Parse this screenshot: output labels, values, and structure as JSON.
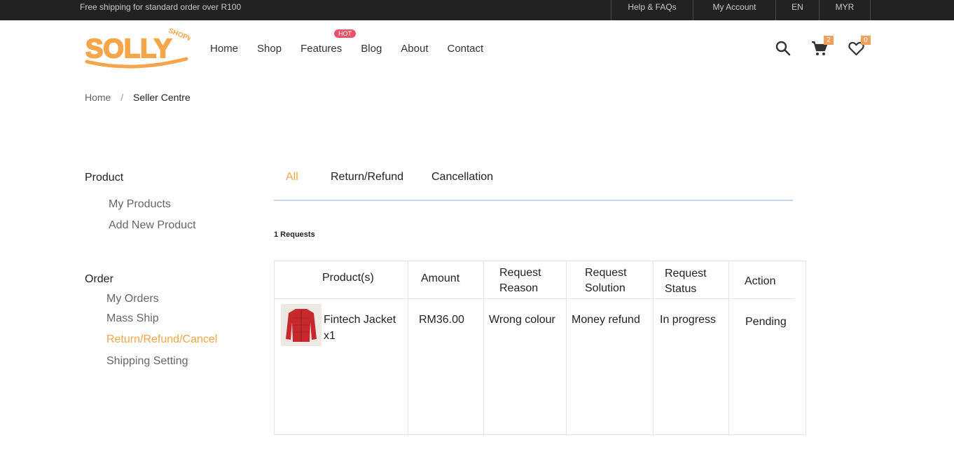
{
  "topbar": {
    "promo": "Free shipping for standard order over R100",
    "links": [
      "Help & FAQs",
      "My Account",
      "EN",
      "MYR"
    ]
  },
  "logo": {
    "main": "SOLLY",
    "sub": "SHOPWE"
  },
  "nav": {
    "items": [
      "Home",
      "Shop",
      "Features",
      "Blog",
      "About",
      "Contact"
    ],
    "hot_badge": "HOT"
  },
  "header": {
    "cart_count": "2",
    "wishlist_count": "0"
  },
  "breadcrumb": {
    "home": "Home",
    "sep": "/",
    "current": "Seller Centre"
  },
  "sidebar": {
    "product_heading": "Product",
    "product_items": [
      "My Products",
      "Add New Product"
    ],
    "order_heading": "Order",
    "order_items": [
      "My Orders",
      "Mass Ship",
      "Return/Refund/Cancel",
      "Shipping Setting"
    ]
  },
  "tabs": [
    "All",
    "Return/Refund",
    "Cancellation"
  ],
  "requests_count": "1 Requests",
  "table": {
    "headers": [
      "Product(s)",
      "Amount",
      "Request Reason",
      "Request Solution",
      "Request Status",
      "Action"
    ],
    "rows": [
      {
        "product": "Fintech Jacket x1",
        "amount": "RM36.00",
        "reason": "Wrong colour",
        "solution": "Money refund",
        "status": "In progress",
        "action": "Pending"
      }
    ]
  },
  "colors": {
    "accent": "#f5a54a",
    "topbar_bg": "#222222",
    "hot": "#e8536b",
    "tab_underline": "#c9d3ec"
  }
}
